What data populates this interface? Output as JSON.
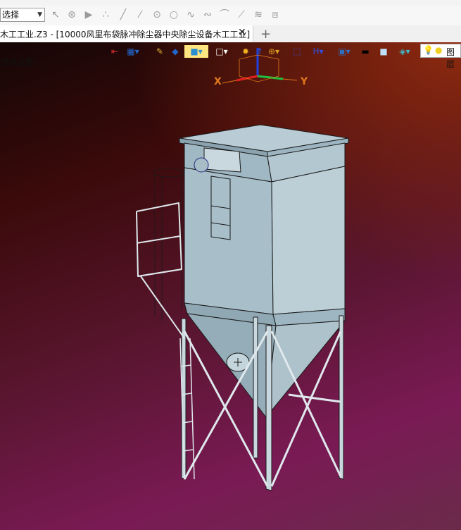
{
  "toolbar": {
    "filter_value": "选择",
    "tools": [
      "select-cursor-icon",
      "pick-icon",
      "play-icon",
      "point-icon",
      "line-icon",
      "line2-icon",
      "circle-center-icon",
      "circle-icon",
      "spline-icon",
      "curve-icon",
      "arc-icon",
      "diagonal-line-icon",
      "stack-icon",
      "layers-icon"
    ]
  },
  "tabs": {
    "active_title": "木工工业.Z3 - [10000风里布袋脉冲除尘器中央除尘设备木工工业]",
    "close_glyph": "✕",
    "add_glyph": "+"
  },
  "viewport": {
    "filter_label": "滤器设置",
    "toolbar_icons": [
      "exit-icon",
      "view-icon",
      "brush-icon",
      "shading-icon",
      "cube-shaded-icon",
      "cube-icon",
      "sun-icon",
      "axis-icon",
      "zoom-icon",
      "fit-icon",
      "bracket-icon",
      "display-icon",
      "black-rect-icon",
      "blue-square-icon",
      "layer-stack-icon",
      "bulb-icon"
    ],
    "layer_label": "图层",
    "axis_x": "X",
    "axis_y": "Y"
  },
  "colors": {
    "background_top_right": "#8e2a10",
    "background_bottom_left": "#7a1a55",
    "model_fill": "#a8bfca",
    "model_edge": "#1a1a1a",
    "axis_red": "#e02020",
    "axis_green": "#20c040",
    "axis_blue": "#2040e0",
    "axis_label": "#e0781c"
  }
}
